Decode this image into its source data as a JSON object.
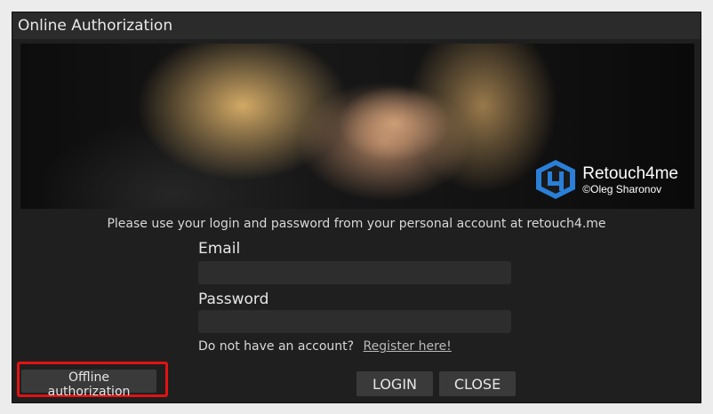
{
  "window": {
    "title": "Online Authorization"
  },
  "banner": {
    "brand_name": "Retouch4me",
    "brand_credit": "©Oleg Sharonov",
    "brand_color": "#2a7fd8"
  },
  "form": {
    "info_text": "Please use your login and password from your personal account at retouch4.me",
    "email_label": "Email",
    "email_value": "",
    "password_label": "Password",
    "password_value": "",
    "no_account_text": "Do not have an account?",
    "register_link": "Register here!"
  },
  "buttons": {
    "offline": "Offline authorization",
    "login": "LOGIN",
    "close": "CLOSE"
  },
  "colors": {
    "highlight": "#e31212",
    "dialog_bg": "#1f1f1f"
  }
}
